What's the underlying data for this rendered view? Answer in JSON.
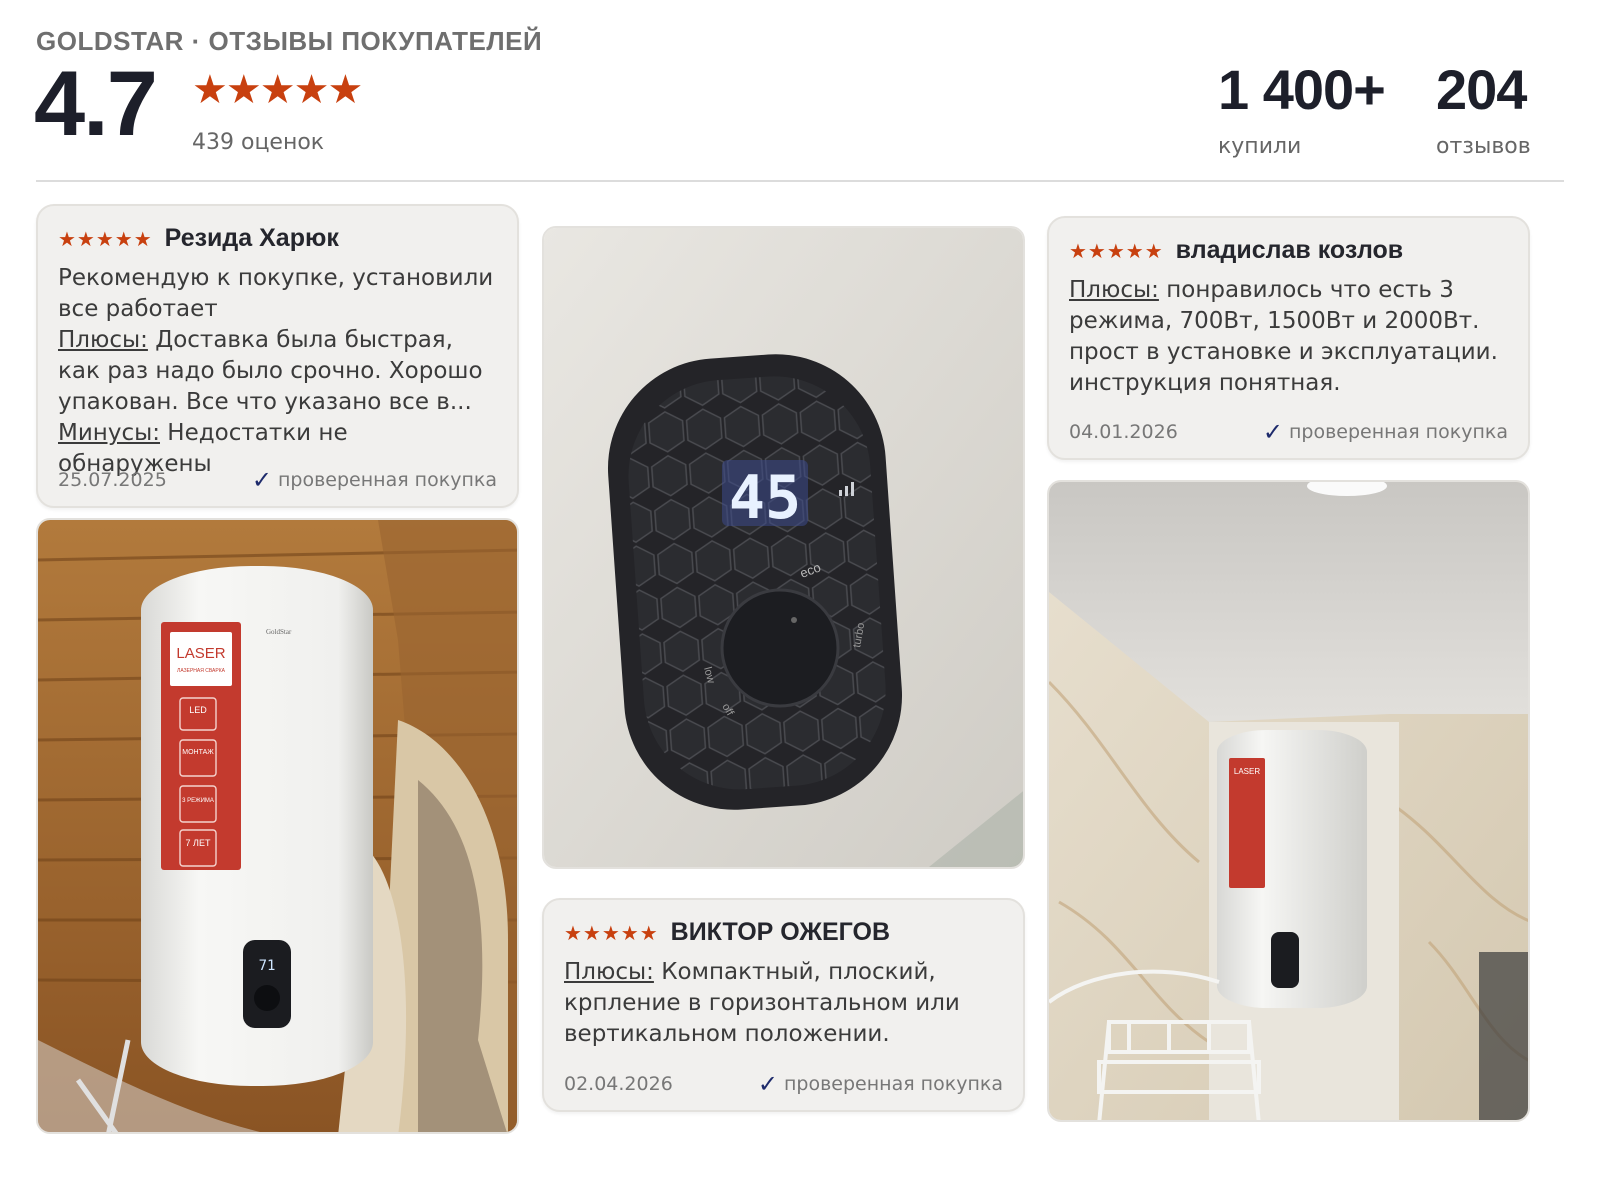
{
  "header": {
    "brand": "GOLDSTAR · ОТЗЫВЫ ПОКУПАТЕЛЕЙ",
    "rating": "4.7",
    "stars": "★★★★★",
    "ratings_count": "439 оценок",
    "stats": [
      {
        "value": "1 400+",
        "label": "купили"
      },
      {
        "value": "204",
        "label": "отзывов"
      }
    ]
  },
  "reviews": [
    {
      "stars": "★★★★★",
      "author": "Резида Харюк",
      "intro": "Рекомендую к покупке, установили все работает",
      "pros_label": "Плюсы:",
      "pros": " Доставка была быстрая, как раз надо было срочно. Хорошо упакован. Все что указано все в...",
      "cons_label": "Минусы:",
      "cons": " Недостатки не обнаружены",
      "date": "25.07.2025",
      "verified": "проверенная покупка"
    },
    {
      "stars": "★★★★★",
      "author": "ВИКТОР ОЖЕГОВ",
      "pros_label": "Плюсы:",
      "pros": " Компактный, плоский, крпление в горизонтальном или вертикальном положении.",
      "date": "02.04.2026",
      "verified": "проверенная покупка"
    },
    {
      "stars": "★★★★★",
      "author": "владислав козлов",
      "pros_label": "Плюсы:",
      "pros": " понравилось что есть 3 режима, 700Вт, 1500Вт и 2000Вт. прост в установке и эксплуатации. инструкция понятная.",
      "date": "04.01.2026",
      "verified": "проверенная покупка"
    }
  ],
  "photos": {
    "heater_label": "LASER",
    "heater_label_sub": "ЛАЗЕРНАЯ СВАРКА",
    "features": [
      "LED",
      "МОНТАЖ",
      "3 РЕЖИМА",
      "7 ЛЕТ"
    ],
    "display_small": "71",
    "display_big": "45",
    "eco": "eco",
    "low": "low",
    "off": "off",
    "turbo": "turbo",
    "maker": "GoldStar"
  },
  "icons": {
    "star": "star-icon",
    "check": "check-icon"
  },
  "colors": {
    "accent_star": "#c8400f",
    "check": "#1d2a6b",
    "card_bg": "#f1f0ee"
  }
}
